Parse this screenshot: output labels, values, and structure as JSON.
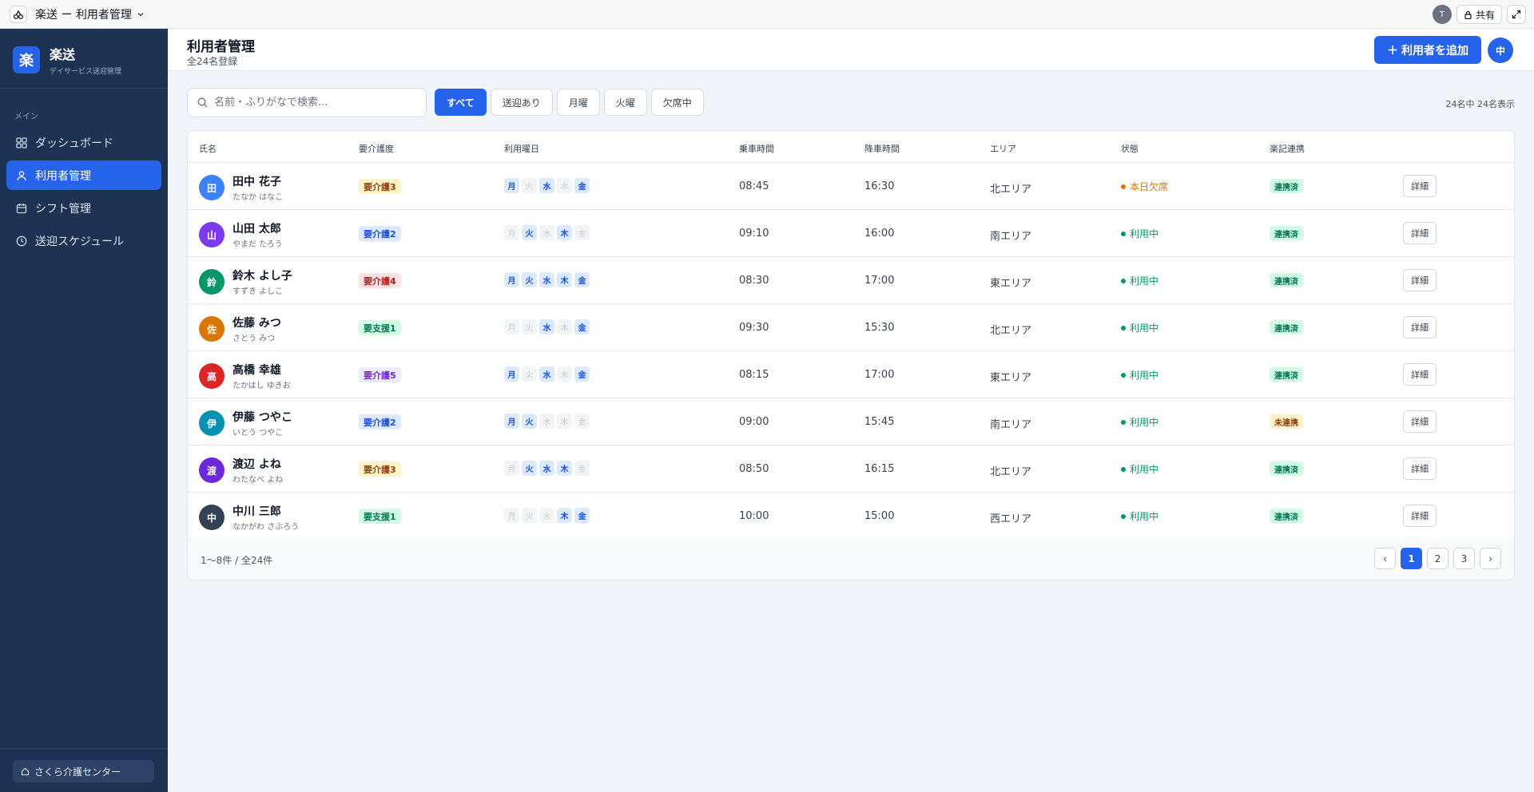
{
  "topbar": {
    "title": "楽送 ー 利用者管理",
    "avatar": "T",
    "share": "共有"
  },
  "brand": {
    "mark": "楽",
    "name": "楽送",
    "sub": "デイサービス送迎管理"
  },
  "nav": {
    "section": "メイン",
    "items": [
      {
        "label": "ダッシュボード",
        "icon": "grid-icon"
      },
      {
        "label": "利用者管理",
        "icon": "user-icon",
        "active": true
      },
      {
        "label": "シフト管理",
        "icon": "calendar-icon"
      },
      {
        "label": "送迎スケジュール",
        "icon": "clock-icon"
      }
    ]
  },
  "facility": "さくら介護センター",
  "header": {
    "title": "利用者管理",
    "subtitle": "全24名登録",
    "add_button": "＋ 利用者を追加",
    "user_avatar": "中"
  },
  "search": {
    "placeholder": "名前・ふりがなで検索..."
  },
  "filters": [
    "すべて",
    "送迎あり",
    "月曜",
    "火曜",
    "欠席中"
  ],
  "result_count": "24名中 24名表示",
  "table": {
    "headers": [
      "氏名",
      "要介護度",
      "利用曜日",
      "乗車時間",
      "降車時間",
      "エリア",
      "状態",
      "楽記連携"
    ],
    "weekdays": [
      "月",
      "火",
      "水",
      "木",
      "金"
    ],
    "detail_label": "詳細",
    "rows": [
      {
        "initial": "田",
        "avatar_color": "#3b82f6",
        "name": "田中 花子",
        "kana": "たなか はなこ",
        "care": "要介護3",
        "care_color": "yellow",
        "days": [
          1,
          0,
          1,
          0,
          1
        ],
        "pickup": "08:45",
        "dropoff": "16:30",
        "area": "北エリア",
        "status": "本日欠席",
        "status_kind": "absent",
        "link": "連携済",
        "link_kind": "ok"
      },
      {
        "initial": "山",
        "avatar_color": "#7c3aed",
        "name": "山田 太郎",
        "kana": "やまだ たろう",
        "care": "要介護2",
        "care_color": "blue",
        "days": [
          0,
          1,
          0,
          1,
          0
        ],
        "pickup": "09:10",
        "dropoff": "16:00",
        "area": "南エリア",
        "status": "利用中",
        "status_kind": "active",
        "link": "連携済",
        "link_kind": "ok"
      },
      {
        "initial": "鈴",
        "avatar_color": "#059669",
        "name": "鈴木 よし子",
        "kana": "すずき よしこ",
        "care": "要介護4",
        "care_color": "red",
        "days": [
          1,
          1,
          1,
          1,
          1
        ],
        "pickup": "08:30",
        "dropoff": "17:00",
        "area": "東エリア",
        "status": "利用中",
        "status_kind": "active",
        "link": "連携済",
        "link_kind": "ok"
      },
      {
        "initial": "佐",
        "avatar_color": "#d97706",
        "name": "佐藤 みつ",
        "kana": "さとう みつ",
        "care": "要支援1",
        "care_color": "green",
        "days": [
          0,
          0,
          1,
          0,
          1
        ],
        "pickup": "09:30",
        "dropoff": "15:30",
        "area": "北エリア",
        "status": "利用中",
        "status_kind": "active",
        "link": "連携済",
        "link_kind": "ok"
      },
      {
        "initial": "高",
        "avatar_color": "#dc2626",
        "name": "高橋 幸雄",
        "kana": "たかはし ゆきお",
        "care": "要介護5",
        "care_color": "purple",
        "days": [
          1,
          0,
          1,
          0,
          1
        ],
        "pickup": "08:15",
        "dropoff": "17:00",
        "area": "東エリア",
        "status": "利用中",
        "status_kind": "active",
        "link": "連携済",
        "link_kind": "ok"
      },
      {
        "initial": "伊",
        "avatar_color": "#0891b2",
        "name": "伊藤 つやこ",
        "kana": "いとう つやこ",
        "care": "要介護2",
        "care_color": "blue",
        "days": [
          1,
          1,
          0,
          0,
          0
        ],
        "pickup": "09:00",
        "dropoff": "15:45",
        "area": "南エリア",
        "status": "利用中",
        "status_kind": "active",
        "link": "未連携",
        "link_kind": "pending"
      },
      {
        "initial": "渡",
        "avatar_color": "#6d28d9",
        "name": "渡辺 よね",
        "kana": "わたなべ よね",
        "care": "要介護3",
        "care_color": "yellow",
        "days": [
          0,
          1,
          1,
          1,
          0
        ],
        "pickup": "08:50",
        "dropoff": "16:15",
        "area": "北エリア",
        "status": "利用中",
        "status_kind": "active",
        "link": "連携済",
        "link_kind": "ok"
      },
      {
        "initial": "中",
        "avatar_color": "#334155",
        "name": "中川 三郎",
        "kana": "なかがわ さぶろう",
        "care": "要支援1",
        "care_color": "green",
        "days": [
          0,
          0,
          0,
          1,
          1
        ],
        "pickup": "10:00",
        "dropoff": "15:00",
        "area": "西エリア",
        "status": "利用中",
        "status_kind": "active",
        "link": "連携済",
        "link_kind": "ok"
      }
    ]
  },
  "pagination": {
    "range": "1〜8件 / 全24件",
    "prev": "‹",
    "next": "›",
    "pages": [
      "1",
      "2",
      "3"
    ],
    "current": "1"
  }
}
